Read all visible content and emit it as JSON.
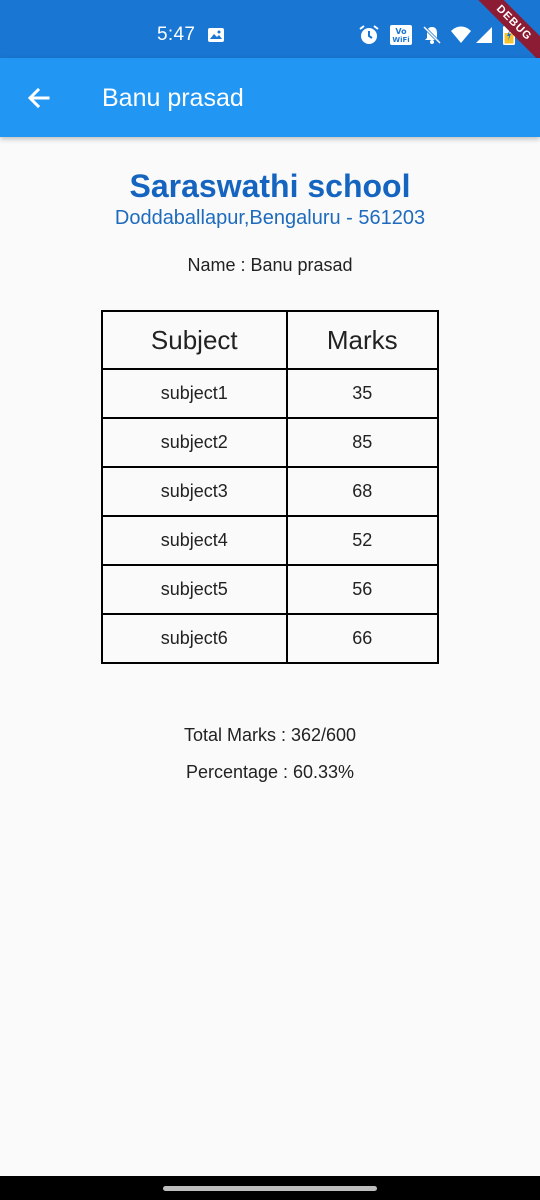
{
  "status_bar": {
    "time": "5:47",
    "icons": [
      "image-icon",
      "alarm-icon",
      "vowifi-icon",
      "bell-off-icon",
      "wifi-icon",
      "signal-icon",
      "battery-icon"
    ],
    "vowifi_label": "Vo WiFi"
  },
  "debug_banner": "DEBUG",
  "app_bar": {
    "title": "Banu prasad",
    "back_icon": "arrow-back-icon",
    "color": "#2196f3"
  },
  "report": {
    "school_name": "Saraswathi school",
    "address": "Doddaballapur,Bengaluru - 561203",
    "student_name": "Name : Banu prasad",
    "table": {
      "headers": [
        "Subject",
        "Marks"
      ],
      "rows": [
        [
          "subject1",
          "35"
        ],
        [
          "subject2",
          "85"
        ],
        [
          "subject3",
          "68"
        ],
        [
          "subject4",
          "52"
        ],
        [
          "subject5",
          "56"
        ],
        [
          "subject6",
          "66"
        ]
      ]
    },
    "total_marks": "Total Marks : 362/600",
    "percentage": "Percentage : 60.33%"
  }
}
